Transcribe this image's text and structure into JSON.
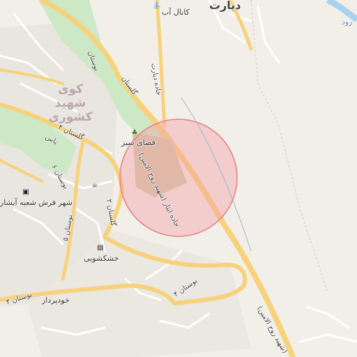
{
  "map": {
    "place_labels": {
      "district": "کوی شهید کشوری",
      "village": "دیارت",
      "river": "رود"
    },
    "road_labels": {
      "shahid_roholamin_1": "جاده ایثار (شهید روح الامین)",
      "shahid_roholamin_2": "(شهید روح الامین)",
      "diyarat_road": "جاده دیارت",
      "golestan_4": "گلستان ۴",
      "golestan_2": "گلستان ۲",
      "bostan_4a": "بوستان ۴",
      "bostan_4b": "بوستان ۴",
      "bostan_5": "بوستان ۵",
      "bostan_6": "بوستان ۶",
      "bostan_top": "بوستان",
      "golestan_top": "گلستان",
      "yas": "یاس"
    },
    "pois": {
      "canal_ab": "کانال آب",
      "green_space": "فضای سبز",
      "carpet_shop": "شهر فرش شعبه آبشار",
      "dry_cleaner": "خشکشویی",
      "khodpardaz": "خودپرداز"
    },
    "icons": {
      "canal": "tap-icon",
      "green_space": "tree-icon",
      "carpet": "shop-icon",
      "dry_cleaner": "laundry-icon",
      "cafe": "cup-icon"
    },
    "colors": {
      "background": "#f2efe9",
      "park": "#cde8c4",
      "main_road": "#f7d27a",
      "minor_road": "#ffffff",
      "highlight_circle": "#f3a2a8",
      "river": "#a9d1f0"
    }
  }
}
